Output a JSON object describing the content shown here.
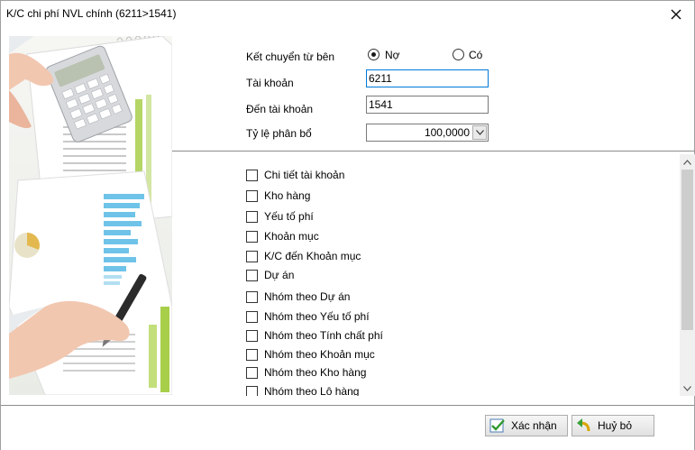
{
  "window": {
    "title": "K/C chi phí NVL chính (6211>1541)"
  },
  "form": {
    "transfer_from_label": "Kết chuyển từ bên",
    "radio_debit_label": "Nợ",
    "radio_credit_label": "Có",
    "selected_side": "Nợ",
    "account_label": "Tài khoản",
    "account_value": "6211",
    "to_account_label": "Đến tài khoản",
    "to_account_value": "1541",
    "ratio_label": "Tỷ lệ phân bổ",
    "ratio_value": "100,0000"
  },
  "options": [
    {
      "label": "Chi tiết tài khoản",
      "checked": false
    },
    {
      "label": "Kho hàng",
      "checked": false
    },
    {
      "label": "Yếu tố phí",
      "checked": false
    },
    {
      "label": "Khoản mục",
      "checked": false
    },
    {
      "label": "K/C đến Khoản mục",
      "checked": false
    },
    {
      "label": "Dự án",
      "checked": false
    },
    {
      "label": "Nhóm theo Dự án",
      "checked": false
    },
    {
      "label": "Nhóm theo Yếu tố phí",
      "checked": false
    },
    {
      "label": "Nhóm theo Tính chất phí",
      "checked": false
    },
    {
      "label": "Nhóm theo Khoản mục",
      "checked": false
    },
    {
      "label": "Nhóm theo Kho hàng",
      "checked": false
    },
    {
      "label": "Nhóm theo Lô hàng",
      "checked": false
    }
  ],
  "buttons": {
    "confirm_label": "Xác nhận",
    "cancel_label": "Huỷ bỏ"
  },
  "icons": {
    "close": "close-icon",
    "confirm": "checkmark-icon",
    "cancel": "undo-arrow-icon",
    "combo": "chevron-down-icon"
  },
  "colors": {
    "focus_border": "#0078d7",
    "divider": "#8c8c8c",
    "chart_green": "#a8cf4a",
    "chart_blue": "#6fc3e8"
  }
}
